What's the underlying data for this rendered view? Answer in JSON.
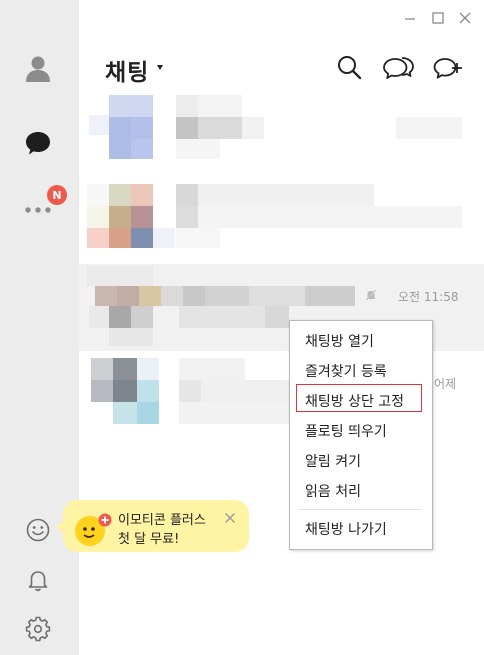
{
  "sidebar": {
    "icons": [
      "profile-icon",
      "chat-icon",
      "more-icon",
      "emoticon-icon",
      "bell-icon",
      "settings-icon"
    ],
    "more_badge": "N"
  },
  "window": {
    "controls": [
      "minimize",
      "maximize",
      "close"
    ]
  },
  "header": {
    "title": "채팅"
  },
  "chat_list": {
    "rows": [
      {
        "time": ""
      },
      {
        "time": ""
      },
      {
        "time": "오전 11:58",
        "muted": true
      },
      {
        "time": "어제"
      }
    ]
  },
  "context_menu": {
    "items": [
      {
        "label": "채팅방 열기"
      },
      {
        "label": "즐겨찾기 등록"
      },
      {
        "label": "채팅방 상단 고정",
        "highlighted": true
      },
      {
        "label": "플로팅 띄우기"
      },
      {
        "label": "알림 켜기"
      },
      {
        "label": "읽음 처리"
      },
      {
        "label": "채팅방 나가기"
      }
    ]
  },
  "promo": {
    "line1": "이모티콘 플러스",
    "line2": "첫 달 무료!"
  },
  "colors": {
    "sidebar_bg": "#ececec",
    "badge": "#f05a4c",
    "highlight_border": "#d9363e",
    "promo_bg": "#fff4a3",
    "emoticon_yellow": "#ffd21f"
  }
}
